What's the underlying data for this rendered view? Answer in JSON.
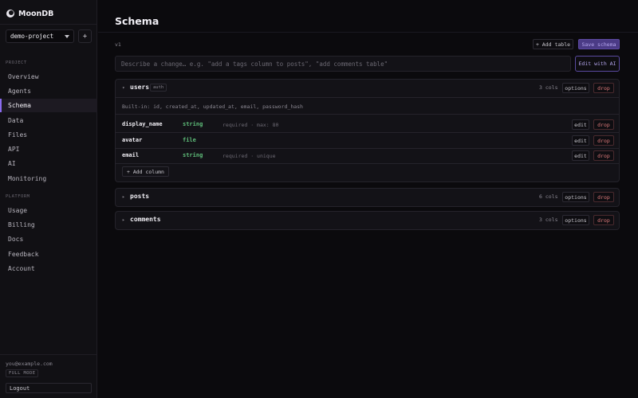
{
  "app": {
    "name": "MoonDB"
  },
  "sidebar": {
    "project": "demo-project",
    "add_label": "+",
    "project_section": "PROJECT",
    "project_items": [
      {
        "label": "Overview"
      },
      {
        "label": "Agents"
      },
      {
        "label": "Schema",
        "active": true
      },
      {
        "label": "Data"
      },
      {
        "label": "Files"
      },
      {
        "label": "API"
      },
      {
        "label": "AI"
      },
      {
        "label": "Monitoring"
      }
    ],
    "platform_section": "PLATFORM",
    "platform_items": [
      {
        "label": "Usage"
      },
      {
        "label": "Billing"
      },
      {
        "label": "Docs"
      },
      {
        "label": "Feedback"
      },
      {
        "label": "Account"
      }
    ],
    "user_email": "you@example.com",
    "plan": "FULL MODE",
    "logout": "Logout"
  },
  "main": {
    "title": "Schema",
    "version": "v1",
    "add_table": "+ Add table",
    "save_schema": "Save schema",
    "prompt_placeholder": "Describe a change… e.g. \"add a tags column to posts\", \"add comments table\"",
    "edit_ai": "Edit with AI",
    "tables": [
      {
        "name": "users",
        "badge": "auth",
        "cols": "3 cols",
        "options": "options",
        "drop": "drop",
        "expanded": true,
        "builtin": "Built-in: id, created_at, updated_at, email, password_hash",
        "fields": [
          {
            "name": "display_name",
            "type": "string",
            "meta": "required · max: 80",
            "edit": "edit",
            "drop": "drop"
          },
          {
            "name": "avatar",
            "type": "file",
            "meta": "",
            "edit": "edit",
            "drop": "drop"
          },
          {
            "name": "email",
            "type": "string",
            "meta": "required · unique",
            "edit": "edit",
            "drop": "drop"
          }
        ],
        "add_column": "+ Add column"
      },
      {
        "name": "posts",
        "cols": "6 cols",
        "options": "options",
        "drop": "drop",
        "expanded": false
      },
      {
        "name": "comments",
        "cols": "3 cols",
        "options": "options",
        "drop": "drop",
        "expanded": false
      }
    ]
  },
  "colors": {
    "accent": "#8b6cf0",
    "type_green": "#5fbf7a",
    "danger": "#e07b7b"
  }
}
